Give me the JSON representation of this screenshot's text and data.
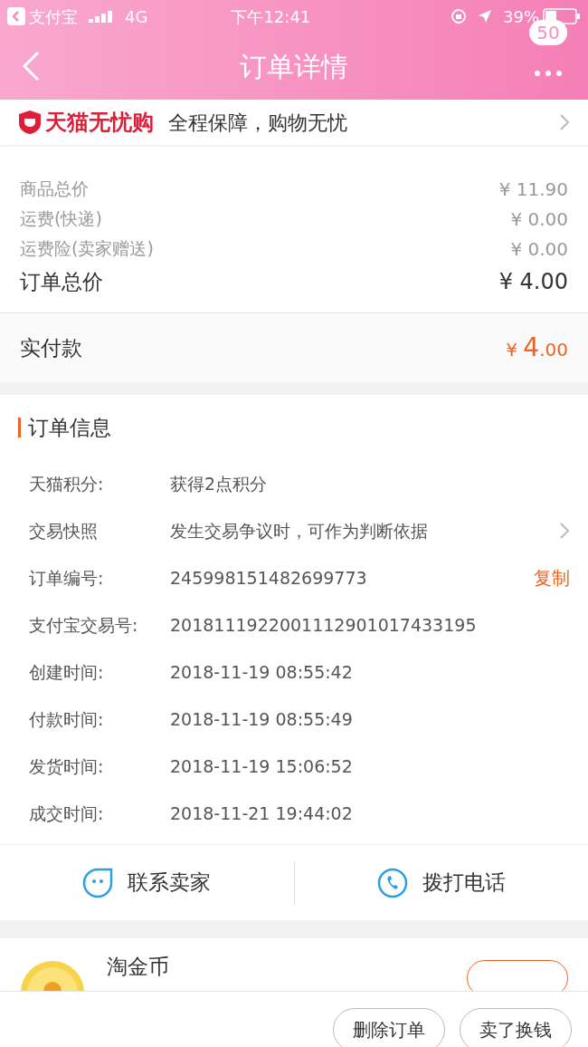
{
  "status_bar": {
    "back_app": "支付宝",
    "network": "4G",
    "time": "下午12:41",
    "battery": "39%"
  },
  "nav": {
    "title": "订单详情",
    "badge": "50"
  },
  "guarantee": {
    "brand": "天猫无忧购",
    "text": "全程保障，购物无忧"
  },
  "prices": [
    {
      "label": "商品总价",
      "value": "¥ 11.90",
      "kind": "minor"
    },
    {
      "label": "运费(快递)",
      "value": "¥ 0.00",
      "kind": "minor"
    },
    {
      "label": "运费险(卖家赠送)",
      "value": "¥ 0.00",
      "kind": "minor"
    },
    {
      "label": "订单总价",
      "value": "¥ 4.00",
      "kind": "total"
    }
  ],
  "paid": {
    "label": "实付款",
    "currency": "¥ ",
    "integer": "4",
    "decimal": ".00"
  },
  "order_info": {
    "title": "订单信息",
    "rows": [
      {
        "label": "天猫积分:",
        "value": "获得2点积分"
      },
      {
        "label": "交易快照",
        "value": "发生交易争议时，可作为判断依据",
        "kind": "link"
      },
      {
        "label": "订单编号:",
        "value": "245998151482699773",
        "action": "复制"
      },
      {
        "label": "支付宝交易号:",
        "value": "2018111922001112901017433195"
      },
      {
        "label": "创建时间:",
        "value": "2018-11-19 08:55:42"
      },
      {
        "label": "付款时间:",
        "value": "2018-11-19 08:55:49"
      },
      {
        "label": "发货时间:",
        "value": "2018-11-19 15:06:52"
      },
      {
        "label": "成交时间:",
        "value": "2018-11-21 19:44:02"
      }
    ]
  },
  "contact": [
    {
      "label": "联系卖家",
      "kind": "chat"
    },
    {
      "label": "拨打电话",
      "kind": "phone"
    }
  ],
  "coin_card": {
    "title": "淘金币"
  },
  "bottom_buttons": [
    "删除订单",
    "卖了换钱"
  ]
}
